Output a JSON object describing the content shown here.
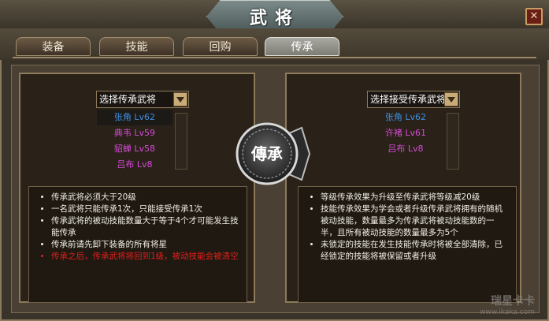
{
  "window": {
    "title": "武将",
    "close_symbol": "✕"
  },
  "tabs": [
    {
      "label": "装备",
      "active": false
    },
    {
      "label": "技能",
      "active": false
    },
    {
      "label": "回购",
      "active": false
    },
    {
      "label": "传承",
      "active": true
    }
  ],
  "left_panel": {
    "select_label": "选择传承武将",
    "generals": [
      {
        "name": "张角 Lv62",
        "color": "#3d8ee0",
        "selected": true
      },
      {
        "name": "典韦 Lv59",
        "color": "#d64bd8",
        "selected": false
      },
      {
        "name": "貂蝉 Lv58",
        "color": "#d64bd8",
        "selected": false
      },
      {
        "name": "吕布 Lv8",
        "color": "#d64bd8",
        "selected": false
      }
    ],
    "rules": [
      {
        "text": "传承武将必须大于20级",
        "warn": false
      },
      {
        "text": "一名武将只能传承1次，只能接受传承1次",
        "warn": false
      },
      {
        "text": "传承武将的被动技能数量大于等于4个才可能发生技能传承",
        "warn": false
      },
      {
        "text": "传承前请先卸下装备的所有将星",
        "warn": false
      },
      {
        "text": "传承之后，传承武将将回到1级，被动技能会被清空",
        "warn": true
      }
    ]
  },
  "right_panel": {
    "select_label": "选择接受传承武将",
    "generals": [
      {
        "name": "张角 Lv62",
        "color": "#3d8ee0",
        "selected": false
      },
      {
        "name": "许褚 Lv61",
        "color": "#d64bd8",
        "selected": false
      },
      {
        "name": "吕布 Lv8",
        "color": "#d64bd8",
        "selected": false
      }
    ],
    "rules": [
      {
        "text": "等级传承效果为升级至传承武将等级减20级",
        "warn": false
      },
      {
        "text": "技能传承效果为学会或者升级传承武将拥有的随机被动技能，数量最多为传承武将被动技能数的一半，且所有被动技能的数量最多为5个",
        "warn": false
      },
      {
        "text": "未锁定的技能在发生技能传承时将被全部清除，已经锁定的技能将被保留或者升级",
        "warn": false
      }
    ]
  },
  "inherit_button": {
    "label": "傳承"
  },
  "watermark": {
    "main": "瑞星卡卡",
    "sub": "www.ikaka.com"
  },
  "colors": {
    "accent_blue": "#3d8ee0",
    "accent_purple": "#d64bd8",
    "warn_red": "#e0201a"
  }
}
